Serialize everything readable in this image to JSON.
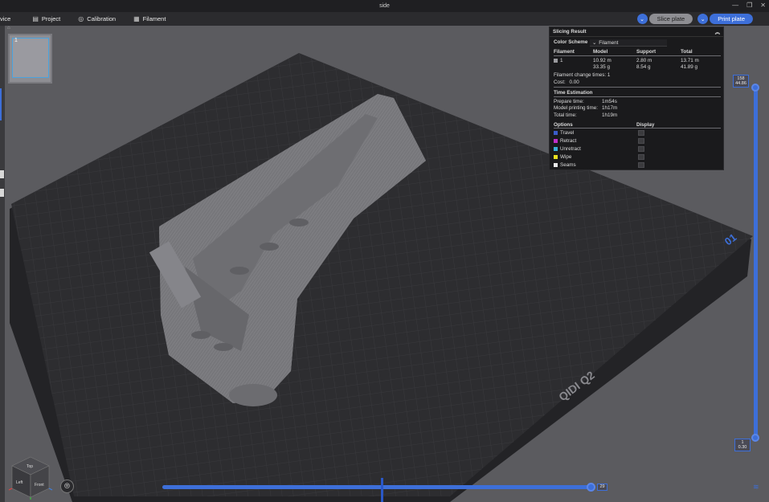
{
  "window": {
    "title": "side"
  },
  "toolbar": {
    "device_label": "vice",
    "items": [
      {
        "label": "Project",
        "icon": "project-icon"
      },
      {
        "label": "Calibration",
        "icon": "calibration-icon"
      },
      {
        "label": "Filament",
        "icon": "filament-icon"
      }
    ],
    "slice_label": "Slice plate",
    "print_label": "Print plate"
  },
  "plate": {
    "number": "1"
  },
  "bed": {
    "brand": "QIDI Q2",
    "marker": "01"
  },
  "slicing_result": {
    "title": "Slicing Result",
    "color_scheme_label": "Color Scheme",
    "color_scheme_value": "Filament",
    "headers": [
      "Filament",
      "Model",
      "Support",
      "Total"
    ],
    "filament_row": {
      "id": "1",
      "model_len": "10.92 m",
      "model_wt": "33.35 g",
      "support_len": "2.80 m",
      "support_wt": "8.54 g",
      "total_len": "13.71 m",
      "total_wt": "41.89 g"
    },
    "change_times_label": "Filament change times:",
    "change_times_value": "1",
    "cost_label": "Cost:",
    "cost_value": "0.00",
    "time_title": "Time Estimation",
    "prepare_label": "Prepare time:",
    "prepare_value": "1m54s",
    "model_time_label": "Model printing time:",
    "model_time_value": "1h17m",
    "total_time_label": "Total time:",
    "total_time_value": "1h19m",
    "options_header": "Options",
    "display_header": "Display",
    "options": [
      {
        "label": "Travel",
        "color": "#3b5cc9"
      },
      {
        "label": "Retract",
        "color": "#c02fc8"
      },
      {
        "label": "Unretract",
        "color": "#3ab0d8"
      },
      {
        "label": "Wipe",
        "color": "#e8e020"
      },
      {
        "label": "Seams",
        "color": "#e8e8e8"
      }
    ]
  },
  "layer_slider": {
    "top_layer": "158",
    "top_height": "44.86",
    "bottom_layer": "1",
    "bottom_height": "0.30"
  },
  "move_slider": {
    "value": "29"
  },
  "view_cube": {
    "top": "Top",
    "left": "Left",
    "front": "Front"
  },
  "colors": {
    "accent": "#3d6fd9",
    "panel_bg": "#1a1a1c",
    "bed": "#2c2c2f"
  }
}
